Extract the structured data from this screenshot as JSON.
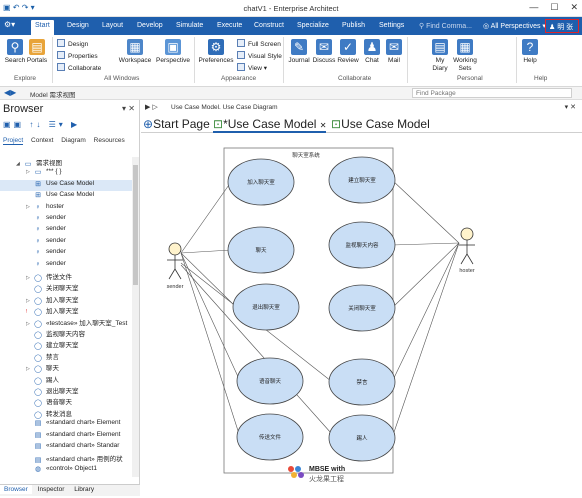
{
  "app": {
    "title": "chatV1 - Enterprise Architect",
    "find_commands": "Find Comma...",
    "perspectives": "All Perspectives",
    "user": "明 张"
  },
  "tabs": [
    "Start",
    "Design",
    "Layout",
    "Develop",
    "Simulate",
    "Execute",
    "Construct",
    "Specialize",
    "Publish",
    "Settings"
  ],
  "ribbon": {
    "explore": {
      "label": "Explore",
      "search": "Search",
      "portals": "Portals"
    },
    "all_windows": {
      "label": "All Windows",
      "design": "Design",
      "properties": "Properties",
      "collaborate": "Collaborate",
      "workspace": "Workspace",
      "perspective": "Perspective"
    },
    "appearance": {
      "label": "Appearance",
      "preferences": "Preferences",
      "full_screen": "Full Screen",
      "visual_style": "Visual Style",
      "view": "View"
    },
    "collaborate": {
      "label": "Collaborate",
      "journal": "Journal",
      "discuss": "Discuss",
      "review": "Review",
      "chat": "Chat",
      "mail": "Mail"
    },
    "personal": {
      "label": "Personal",
      "my_diary": "My Diary",
      "working_sets": "Working Sets"
    },
    "help": {
      "label": "Help",
      "help": "Help"
    }
  },
  "address": {
    "path": "Model  需求视图",
    "find_package": "Find Package"
  },
  "browser": {
    "title": "Browser",
    "tabs": [
      "Project",
      "Context",
      "Diagram",
      "Resources"
    ],
    "bottom_tabs": [
      "Browser",
      "Inspector",
      "Library"
    ],
    "items": [
      {
        "label": "需求视图",
        "icon": "package-icon",
        "indent": 1,
        "expand": "◢"
      },
      {
        "label": "*** { }",
        "icon": "package-icon",
        "indent": 2,
        "expand": "▷"
      },
      {
        "label": "Use Case Model",
        "icon": "diagram-icon",
        "indent": 2,
        "expand": "",
        "selected": true
      },
      {
        "label": "Use Case Model",
        "icon": "diagram-icon",
        "indent": 2,
        "expand": ""
      },
      {
        "label": "hoster",
        "icon": "actor-icon",
        "indent": 2,
        "expand": "▷"
      },
      {
        "label": "sender",
        "icon": "actor-icon",
        "indent": 2,
        "expand": ""
      },
      {
        "label": "sender",
        "icon": "actor-icon",
        "indent": 2,
        "expand": ""
      },
      {
        "label": "sender",
        "icon": "actor-icon",
        "indent": 2,
        "expand": ""
      },
      {
        "label": "sender",
        "icon": "actor-icon",
        "indent": 2,
        "expand": ""
      },
      {
        "label": "sender",
        "icon": "actor-icon",
        "indent": 2,
        "expand": ""
      },
      {
        "label": "传送文件",
        "icon": "usecase-icon",
        "indent": 2,
        "expand": "▷"
      },
      {
        "label": "关闭聊天室",
        "icon": "usecase-icon",
        "indent": 2,
        "expand": ""
      },
      {
        "label": "加入聊天室",
        "icon": "usecase-icon",
        "indent": 2,
        "expand": "▷"
      },
      {
        "label": "加入聊天室",
        "icon": "usecase-icon",
        "indent": 2,
        "expand": "!"
      },
      {
        "label": "«testcase» 加入聊天室_Test",
        "icon": "usecase-icon",
        "indent": 2,
        "expand": "▷"
      },
      {
        "label": "监视聊天内容",
        "icon": "usecase-icon",
        "indent": 2,
        "expand": ""
      },
      {
        "label": "建立聊天室",
        "icon": "usecase-icon",
        "indent": 2,
        "expand": ""
      },
      {
        "label": "禁言",
        "icon": "usecase-icon",
        "indent": 2,
        "expand": ""
      },
      {
        "label": "聊天",
        "icon": "usecase-icon",
        "indent": 2,
        "expand": "▷"
      },
      {
        "label": "踢人",
        "icon": "usecase-icon",
        "indent": 2,
        "expand": ""
      },
      {
        "label": "退出聊天室",
        "icon": "usecase-icon",
        "indent": 2,
        "expand": ""
      },
      {
        "label": "语音聊天",
        "icon": "usecase-icon",
        "indent": 2,
        "expand": ""
      },
      {
        "label": "转发消息",
        "icon": "usecase-icon",
        "indent": 2,
        "expand": ""
      },
      {
        "label": "«standard chart» Element",
        "icon": "chart-icon",
        "indent": 2,
        "expand": ""
      },
      {
        "label": "«standard chart» Element",
        "icon": "chart-icon",
        "indent": 2,
        "expand": ""
      },
      {
        "label": "«standard chart» Standar",
        "icon": "chart-icon",
        "indent": 2,
        "expand": ""
      },
      {
        "label": "«standard chart» 用例的状",
        "icon": "chart-icon",
        "indent": 2,
        "expand": ""
      },
      {
        "label": "«control» Object1",
        "icon": "control-icon",
        "indent": 2,
        "expand": ""
      }
    ]
  },
  "document": {
    "breadcrumb": "Use Case Model.  Use Case Diagram",
    "tabs": [
      "Start Page",
      "*Use Case Model",
      "Use Case Model"
    ]
  },
  "diagram": {
    "boundary_title": "聊天室系统",
    "actors": [
      "sender",
      "hoster"
    ],
    "usecases_left": [
      "加入聊天室",
      "聊天",
      "退出聊天室",
      "语音聊天",
      "传送文件"
    ],
    "usecases_right": [
      "建立聊天室",
      "监视聊天内容",
      "关闭聊天室",
      "禁言",
      "踢人"
    ],
    "watermark": "MBSE with",
    "watermark2": "火龙果工程"
  }
}
